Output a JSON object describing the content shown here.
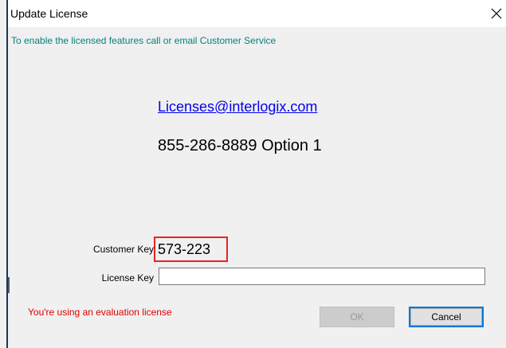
{
  "window": {
    "title": "Update License",
    "close_icon": "close-x-icon"
  },
  "info": {
    "subtitle": "To enable the licensed features call or email Customer Service",
    "email": "Licenses@interlogix.com",
    "phone": "855-286-8889 Option 1"
  },
  "form": {
    "customer_key_label": "Customer Key",
    "customer_key_value": "573-223",
    "license_key_label": "License Key",
    "license_key_value": "",
    "license_key_placeholder": ""
  },
  "status": {
    "warning": "You're using an evaluation license"
  },
  "buttons": {
    "ok_label": "OK",
    "cancel_label": "Cancel"
  },
  "colors": {
    "subtitle": "#008080",
    "link": "#0000ee",
    "warning": "#e00000",
    "highlight_box": "#e82424",
    "focus_border": "#0078d7"
  }
}
